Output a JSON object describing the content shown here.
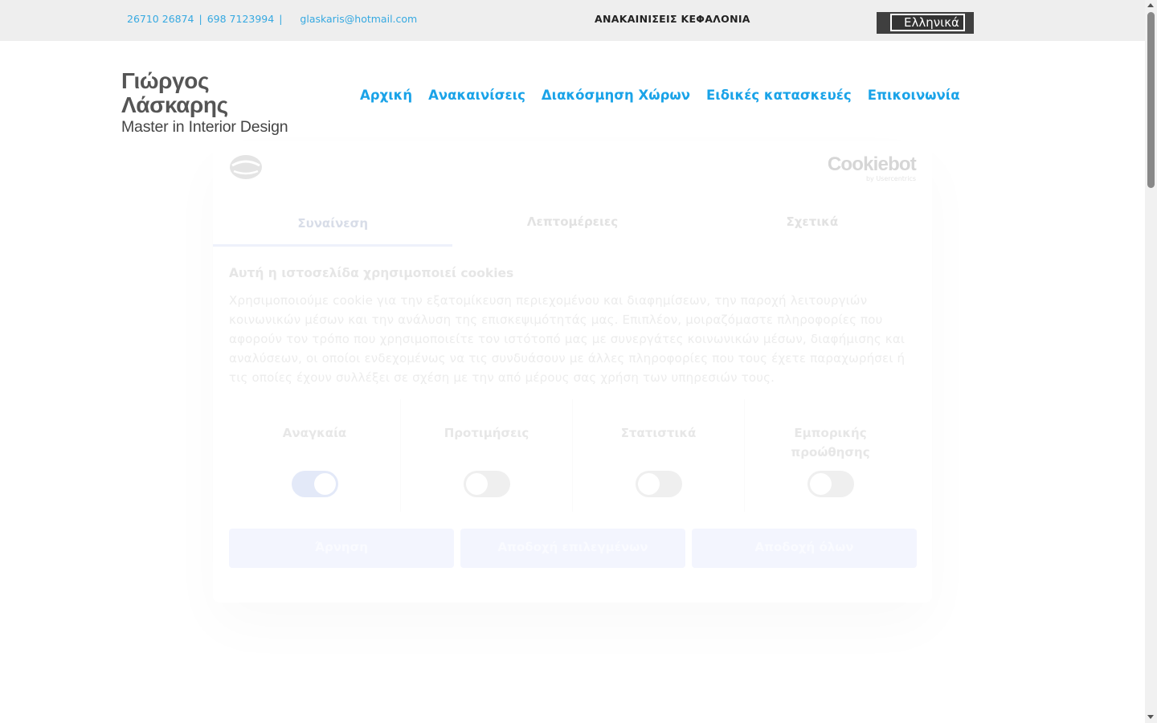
{
  "topbar": {
    "phone1": "26710 26874",
    "phone2": "698 7123994",
    "separator": "|",
    "email": "glaskaris@hotmail.com",
    "tagline": "ΑΝΑΚΑΙΝΙΣΕΙΣ ΚΕΦΑΛΟΝΙΑ",
    "language": "Ελληνικά"
  },
  "logo": {
    "name": "Γιώργος Λάσκαρης",
    "subtitle": "Master in Interior Design"
  },
  "nav": {
    "items": [
      "Αρχική",
      "Ανακαινίσεις",
      "Διακόσμηση Χώρων",
      "Ειδικές κατασκευές",
      "Επικοινωνία"
    ]
  },
  "cookie_dialog": {
    "brand": "Cookiebot",
    "brand_sub": "by Usercentrics",
    "tabs": [
      "Συναίνεση",
      "Λεπτομέρειες",
      "Σχετικά"
    ],
    "active_tab": "Συναίνεση",
    "title": "Αυτή η ιστοσελίδα χρησιμοποιεί cookies",
    "text": "Χρησιμοποιούμε cookie για την εξατομίκευση περιεχομένου και διαφημίσεων, την παροχή λειτουργιών κοινωνικών μέσων και την ανάλυση της επισκεψιμότητάς μας. Επιπλέον, μοιραζόμαστε πληροφορίες που αφορούν τον τρόπο που χρησιμοποιείτε τον ιστότοπό μας με συνεργάτες κοινωνικών μέσων, διαφήμισης και αναλύσεων, οι οποίοι ενδεχομένως να τις συνδυάσουν με άλλες πληροφορίες που τους έχετε παραχωρήσει ή τις οποίες έχουν συλλέξει σε σχέση με την από μέρους σας χρήση των υπηρεσιών τους.",
    "toggles": [
      {
        "label": "Αναγκαία",
        "on": true
      },
      {
        "label": "Προτιμήσεις",
        "on": false
      },
      {
        "label": "Στατιστικά",
        "on": false
      },
      {
        "label": "Εμπορικής προώθησης",
        "on": false
      }
    ],
    "buttons": {
      "deny": "Άρνηση",
      "accept_selected": "Αποδοχή επιλεγμένων",
      "accept_all": "Αποδοχή όλων"
    }
  },
  "colors": {
    "link_blue": "#1aa3e8",
    "topbar_bg": "#eeeeee",
    "lang_bg": "#3f3f3f"
  }
}
